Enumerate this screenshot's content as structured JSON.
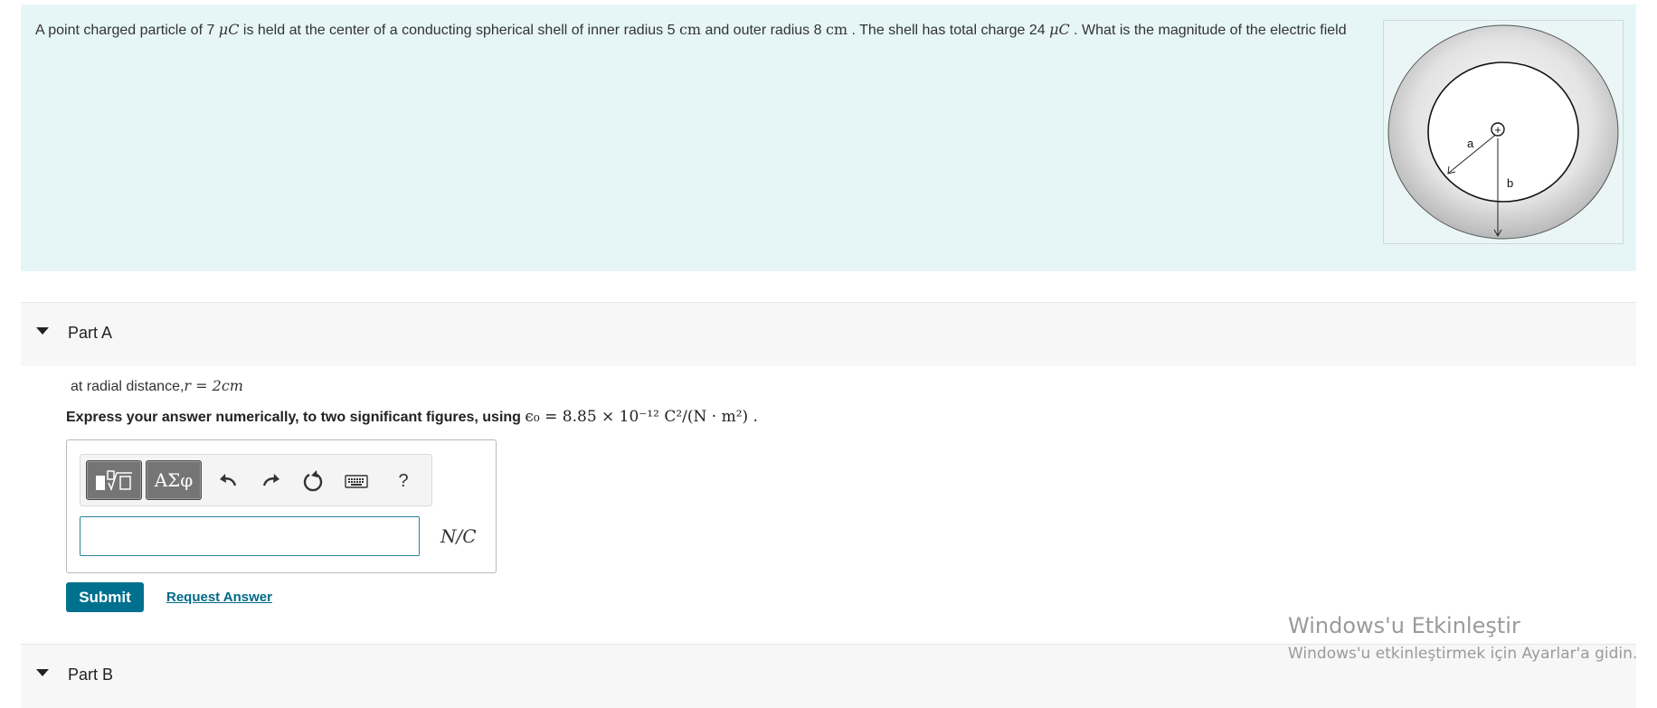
{
  "intro": {
    "text_parts": [
      "A point charged particle of 7 ",
      "μC",
      " is held at the center of a conducting spherical shell of inner radius 5 ",
      "cm",
      " and outer radius 8 ",
      "cm",
      " . The shell has total charge 24 ",
      "μC",
      " . What is the magnitude of the electric field"
    ],
    "figure": {
      "label_a": "a",
      "label_b": "b",
      "charge_symbol": "+"
    }
  },
  "part_a": {
    "title": "Part A",
    "prompt_prefix": "at radial distance,",
    "prompt_math": "r = 2cm",
    "instruction": "Express your answer numerically, to two significant figures, using ",
    "instruction_math": "ϵ₀ = 8.85 × 10⁻¹² C²/(N · m²) .",
    "answer_value": "",
    "answer_unit": "N/C",
    "toolbar": {
      "symbols_label": "ΑΣφ",
      "help_label": "?",
      "icons": [
        "templates-icon",
        "symbols-icon",
        "undo-icon",
        "redo-icon",
        "reset-icon",
        "keyboard-icon",
        "help-icon"
      ]
    },
    "submit_label": "Submit",
    "request_answer_label": "Request Answer"
  },
  "part_b": {
    "title": "Part B"
  },
  "watermark": {
    "title": "Windows'u Etkinleştir",
    "subtitle": "Windows'u etkinleştirmek için Ayarlar'a gidin."
  },
  "colors": {
    "intro_bg": "#e6f6f6",
    "submit_bg": "#00708f",
    "link": "#006a87",
    "input_border": "#2d7f9a"
  }
}
